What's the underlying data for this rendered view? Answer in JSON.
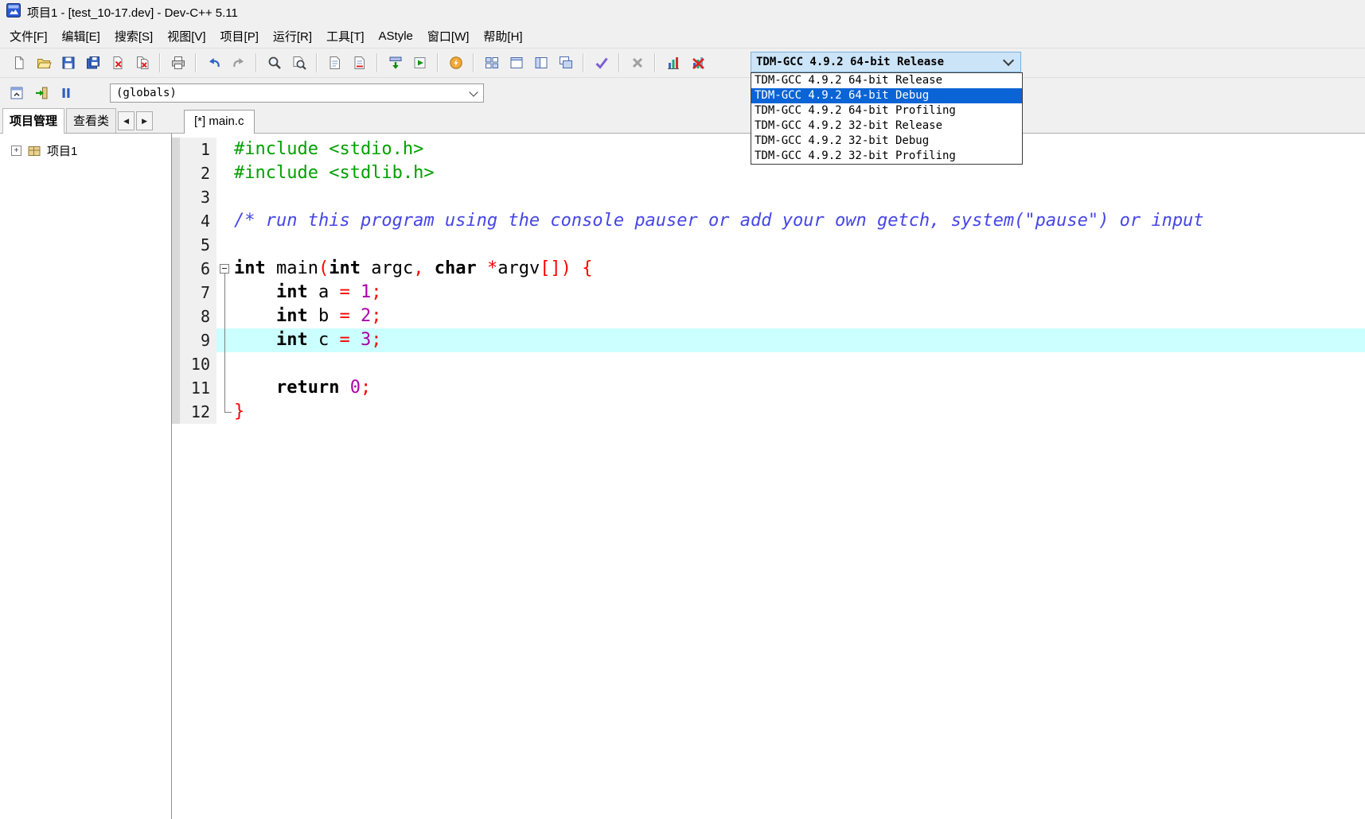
{
  "window": {
    "title": "项目1 - [test_10-17.dev] - Dev-C++ 5.11"
  },
  "menubar": {
    "items": [
      "文件[F]",
      "编辑[E]",
      "搜索[S]",
      "视图[V]",
      "项目[P]",
      "运行[R]",
      "工具[T]",
      "AStyle",
      "窗口[W]",
      "帮助[H]"
    ]
  },
  "toolbar_main": {
    "groups": [
      [
        "new-file",
        "open",
        "save",
        "save-all",
        "close",
        "close-all"
      ],
      [
        "print"
      ],
      [
        "undo",
        "redo"
      ],
      [
        "find",
        "find-in-files"
      ],
      [
        "add-file",
        "remove-file"
      ],
      [
        "compile",
        "run"
      ],
      [
        "compile-run"
      ],
      [
        "panel-grid",
        "panel-single",
        "panel-split",
        "panel-cascade"
      ],
      [
        "syntax-check"
      ],
      [
        "abort"
      ],
      [
        "profile",
        "profile-delete"
      ]
    ],
    "compiler_combo": {
      "value": "TDM-GCC 4.9.2 64-bit Release",
      "open": true,
      "options": [
        "TDM-GCC 4.9.2 64-bit Release",
        "TDM-GCC 4.9.2 64-bit Debug",
        "TDM-GCC 4.9.2 64-bit Profiling",
        "TDM-GCC 4.9.2 32-bit Release",
        "TDM-GCC 4.9.2 32-bit Debug",
        "TDM-GCC 4.9.2 32-bit Profiling"
      ],
      "highlighted_option": "TDM-GCC 4.9.2 64-bit Debug"
    }
  },
  "toolbar_second": {
    "icons": [
      "window-toggle",
      "step-into",
      "pause"
    ],
    "globals_combo": {
      "value": "(globals)"
    }
  },
  "sidebar": {
    "tabs": [
      {
        "label": "项目管理",
        "active": true
      },
      {
        "label": "查看类",
        "active": false
      }
    ],
    "tab_scroll": {
      "left": "◀",
      "right": "▶"
    },
    "tree": [
      {
        "label": "项目1",
        "expand_glyph": "+"
      }
    ]
  },
  "editor": {
    "tabs": [
      {
        "label": "[*] main.c",
        "active": true
      }
    ],
    "highlighted_line": 9,
    "lines": [
      {
        "n": 1,
        "seg": [
          [
            "pp",
            "#include <stdio.h>"
          ]
        ]
      },
      {
        "n": 2,
        "seg": [
          [
            "pp",
            "#include <stdlib.h>"
          ]
        ]
      },
      {
        "n": 3,
        "seg": []
      },
      {
        "n": 4,
        "seg": [
          [
            "cm",
            "/* run this program using the console pauser or add your own getch, system(\"pause\") or input"
          ]
        ]
      },
      {
        "n": 5,
        "seg": []
      },
      {
        "n": 6,
        "fold": "start",
        "seg": [
          [
            "kw",
            "int"
          ],
          [
            "pl",
            " main"
          ],
          [
            "sy",
            "("
          ],
          [
            "kw",
            "int"
          ],
          [
            "pl",
            " argc"
          ],
          [
            "sy",
            ","
          ],
          [
            "pl",
            " "
          ],
          [
            "kw",
            "char"
          ],
          [
            "pl",
            " "
          ],
          [
            "sy",
            "*"
          ],
          [
            "pl",
            "argv"
          ],
          [
            "sy",
            "[])"
          ],
          [
            "pl",
            " "
          ],
          [
            "sy",
            "{"
          ]
        ]
      },
      {
        "n": 7,
        "fold": "mid",
        "seg": [
          [
            "pl",
            "    "
          ],
          [
            "kw",
            "int"
          ],
          [
            "pl",
            " a "
          ],
          [
            "sy",
            "="
          ],
          [
            "pl",
            " "
          ],
          [
            "nu",
            "1"
          ],
          [
            "sy",
            ";"
          ]
        ]
      },
      {
        "n": 8,
        "fold": "mid",
        "seg": [
          [
            "pl",
            "    "
          ],
          [
            "kw",
            "int"
          ],
          [
            "pl",
            " b "
          ],
          [
            "sy",
            "="
          ],
          [
            "pl",
            " "
          ],
          [
            "nu",
            "2"
          ],
          [
            "sy",
            ";"
          ]
        ]
      },
      {
        "n": 9,
        "fold": "mid",
        "hl": true,
        "seg": [
          [
            "pl",
            "    "
          ],
          [
            "kw",
            "int"
          ],
          [
            "pl",
            " c "
          ],
          [
            "sy",
            "="
          ],
          [
            "pl",
            " "
          ],
          [
            "nu",
            "3"
          ],
          [
            "sy",
            ";"
          ]
        ]
      },
      {
        "n": 10,
        "fold": "mid",
        "seg": []
      },
      {
        "n": 11,
        "fold": "mid",
        "seg": [
          [
            "pl",
            "    "
          ],
          [
            "kw",
            "return"
          ],
          [
            "pl",
            " "
          ],
          [
            "nu",
            "0"
          ],
          [
            "sy",
            ";"
          ]
        ]
      },
      {
        "n": 12,
        "fold": "end",
        "seg": [
          [
            "sy",
            "}"
          ]
        ]
      }
    ]
  },
  "colors": {
    "line_highlight": "#CCFFFF",
    "selection_blue": "#0A64D6",
    "combo_focus_bg": "#CCE4F7",
    "preprocessor_green": "#00A000",
    "comment_blue": "#4646E6",
    "symbol_red": "#FF0000",
    "number_purple": "#AA00AA"
  }
}
